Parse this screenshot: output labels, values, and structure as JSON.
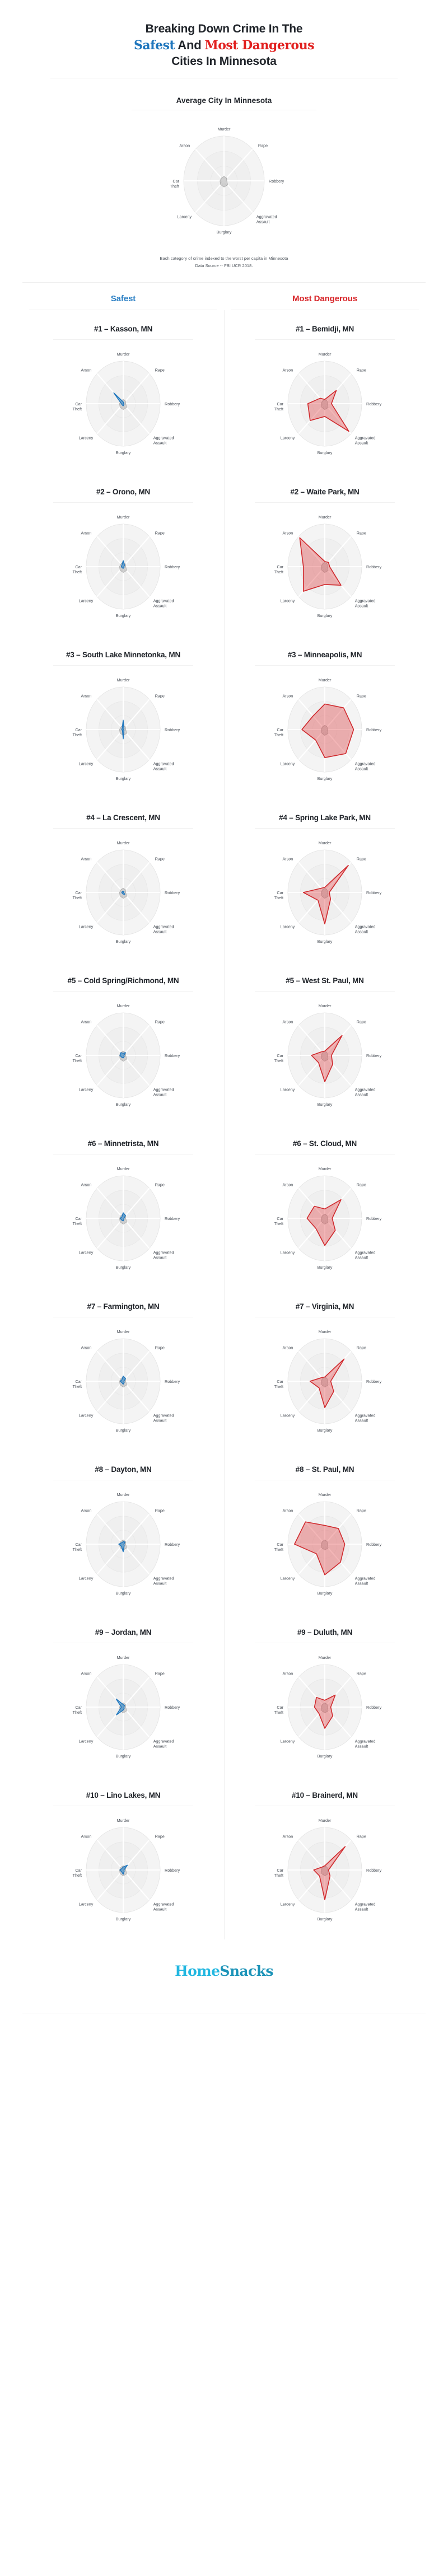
{
  "header": {
    "line1": "Breaking Down Crime In The",
    "line2_pre": "",
    "safest_word": "Safest",
    "line2_mid": " And ",
    "dangerous_word": "Most Dangerous",
    "line3": "Cities In Minnesota",
    "safest_color": "#1f76bd",
    "dangerous_color": "#e1201f"
  },
  "average": {
    "title": "Average City In Minnesota"
  },
  "caption": {
    "line1": "Each category of crime indexed to the worst per capita in Minnesota",
    "line2": "Data Source -- FBI UCR 2018."
  },
  "columns": {
    "safest_label": "Safest",
    "dangerous_label": "Most Dangerous"
  },
  "footer": {
    "logo_part1": "Home",
    "logo_part2": "Snacks",
    "logo_color1": "#22b7e0",
    "logo_color2": "#1b93b8"
  },
  "chart_data": {
    "type": "radar",
    "title": "Breaking Down Crime In The Safest And Most Dangerous Cities In Minnesota",
    "subtitle": "Each category of crime indexed to the worst per capita in Minnesota",
    "source": "Data Source -- FBI UCR 2018.",
    "axes": [
      "Murder",
      "Rape",
      "Robbery",
      "Aggravated Assault",
      "Burglary",
      "Larceny",
      "Car Theft",
      "Arson"
    ],
    "rmax": 1.0,
    "grid_rings": [
      0.33,
      0.66,
      1.0
    ],
    "legend": [
      "Average City In Minnesota",
      "Safest City",
      "Most Dangerous City"
    ],
    "colors": {
      "average": "#a9a9a9",
      "safest": "#2f86c8",
      "dangerous": "#e0484a"
    },
    "average_series": {
      "name": "Average City In Minnesota",
      "values": [
        0.1,
        0.09,
        0.07,
        0.13,
        0.14,
        0.12,
        0.1,
        0.09
      ]
    },
    "safest": [
      {
        "rank": "#1",
        "city": "Kasson, MN",
        "title": "#1 – Kasson, MN",
        "values": [
          0.04,
          0.02,
          0.01,
          0.03,
          0.05,
          0.04,
          0.05,
          0.36
        ]
      },
      {
        "rank": "#2",
        "city": "Orono, MN",
        "title": "#2 – Orono, MN",
        "values": [
          0.14,
          0.05,
          0.02,
          0.03,
          0.04,
          0.04,
          0.05,
          0.05
        ]
      },
      {
        "rank": "#3",
        "city": "South Lake Minnetonka, MN",
        "title": "#3 – South Lake Minnetonka, MN",
        "values": [
          0.22,
          0.03,
          0.01,
          0.03,
          0.22,
          0.03,
          0.04,
          0.04
        ]
      },
      {
        "rank": "#4",
        "city": "La Crescent, MN",
        "title": "#4 – La Crescent, MN",
        "values": [
          0.02,
          0.03,
          0.01,
          0.06,
          0.04,
          0.03,
          0.04,
          0.03
        ]
      },
      {
        "rank": "#5",
        "city": "Cold Spring/Richmond, MN",
        "title": "#5 – Cold Spring/Richmond, MN",
        "values": [
          0.05,
          0.09,
          0.02,
          0.04,
          0.06,
          0.06,
          0.09,
          0.09
        ]
      },
      {
        "rank": "#6",
        "city": "Minnetrista, MN",
        "title": "#6 – Minnetrista, MN",
        "values": [
          0.13,
          0.09,
          0.02,
          0.03,
          0.06,
          0.06,
          0.08,
          0.05
        ]
      },
      {
        "rank": "#7",
        "city": "Farmington, MN",
        "title": "#7 – Farmington, MN",
        "values": [
          0.12,
          0.09,
          0.02,
          0.04,
          0.07,
          0.05,
          0.08,
          0.05
        ]
      },
      {
        "rank": "#8",
        "city": "Dayton, MN",
        "title": "#8 – Dayton, MN",
        "values": [
          0.06,
          0.07,
          0.02,
          0.04,
          0.18,
          0.07,
          0.12,
          0.05
        ]
      },
      {
        "rank": "#9",
        "city": "Jordan, MN",
        "title": "#9 – Jordan, MN",
        "values": [
          0.06,
          0.05,
          0.02,
          0.04,
          0.07,
          0.26,
          0.05,
          0.27
        ]
      },
      {
        "rank": "#10",
        "city": "Lino Lakes, MN",
        "title": "#10 – Lino Lakes, MN",
        "values": [
          0.07,
          0.16,
          0.02,
          0.04,
          0.1,
          0.06,
          0.09,
          0.05
        ]
      }
    ],
    "dangerous": [
      {
        "rank": "#1",
        "city": "Bemidji, MN",
        "title": "#1 – Bemidji, MN",
        "values": [
          0.1,
          0.44,
          0.18,
          0.92,
          0.3,
          0.56,
          0.46,
          0.18
        ]
      },
      {
        "rank": "#2",
        "city": "Waite Park, MN",
        "title": "#2 – Waite Park, MN",
        "values": [
          0.12,
          0.14,
          0.13,
          0.62,
          0.42,
          0.82,
          0.58,
          0.96
        ]
      },
      {
        "rank": "#3",
        "city": "Minneapolis, MN",
        "title": "#3 – Minneapolis, MN",
        "values": [
          0.6,
          0.72,
          0.78,
          0.8,
          0.66,
          0.35,
          0.62,
          0.45
        ]
      },
      {
        "rank": "#4",
        "city": "Spring Lake Park, MN",
        "title": "#4 – Spring Lake Park, MN",
        "values": [
          0.12,
          0.9,
          0.12,
          0.22,
          0.74,
          0.26,
          0.58,
          0.14
        ]
      },
      {
        "rank": "#5",
        "city": "West St. Paul, MN",
        "title": "#5 – West St. Paul, MN",
        "values": [
          0.1,
          0.66,
          0.18,
          0.3,
          0.62,
          0.24,
          0.36,
          0.12
        ]
      },
      {
        "rank": "#6",
        "city": "St. Cloud, MN",
        "title": "#6 – St. Cloud, MN",
        "values": [
          0.22,
          0.62,
          0.2,
          0.4,
          0.64,
          0.34,
          0.48,
          0.4
        ]
      },
      {
        "rank": "#7",
        "city": "Virginia, MN",
        "title": "#7 – Virginia, MN",
        "values": [
          0.1,
          0.74,
          0.16,
          0.34,
          0.62,
          0.22,
          0.4,
          0.12
        ]
      },
      {
        "rank": "#8",
        "city": "St. Paul, MN",
        "title": "#8 – St. Paul, MN",
        "values": [
          0.44,
          0.52,
          0.54,
          0.6,
          0.72,
          0.32,
          0.82,
          0.74
        ]
      },
      {
        "rank": "#9",
        "city": "Duluth, MN",
        "title": "#9 – Duluth, MN",
        "values": [
          0.16,
          0.4,
          0.16,
          0.3,
          0.5,
          0.22,
          0.28,
          0.32
        ]
      },
      {
        "rank": "#10",
        "city": "Brainerd, MN",
        "title": "#10 – Brainerd, MN",
        "values": [
          0.1,
          0.78,
          0.1,
          0.2,
          0.7,
          0.2,
          0.3,
          0.1
        ]
      }
    ]
  }
}
